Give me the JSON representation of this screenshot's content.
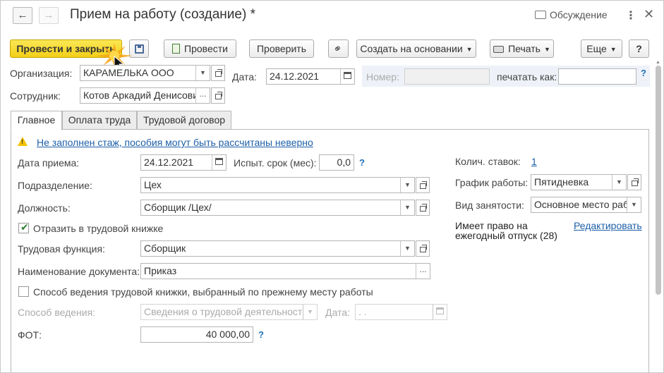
{
  "window": {
    "title": "Прием на работу (создание) *",
    "discussion_label": "Обсуждение"
  },
  "toolbar": {
    "post_close": "Провести и закрыть",
    "post": "Провести",
    "check": "Проверить",
    "create_based": "Создать на основании",
    "print": "Печать",
    "more": "Еще",
    "help": "?"
  },
  "header": {
    "org_label": "Организация:",
    "org_value": "КАРАМЕЛЬКА ООО",
    "date_label": "Дата:",
    "date_value": "24.12.2021",
    "number_label": "Номер:",
    "number_value": "",
    "print_as_label": "печатать как:",
    "print_as_value": "",
    "employee_label": "Сотрудник:",
    "employee_value": "Котов Аркадий Денисови"
  },
  "tabs": [
    "Главное",
    "Оплата труда",
    "Трудовой договор"
  ],
  "main": {
    "warning": "Не заполнен стаж, пособия могут быть рассчитаны неверно",
    "hire_date_label": "Дата приема:",
    "hire_date_value": "24.12.2021",
    "probation_label": "Испыт. срок (мес):",
    "probation_value": "0,0",
    "dept_label": "Подразделение:",
    "dept_value": "Цех",
    "position_label": "Должность:",
    "position_value": "Сборщик /Цех/",
    "workbook_checkbox": "Отразить в трудовой книжке",
    "workbook_checked": true,
    "labor_function_label": "Трудовая функция:",
    "labor_function_value": "Сборщик",
    "doc_name_label": "Наименование документа:",
    "doc_name_value": "Приказ",
    "prev_method_checkbox": "Способ ведения трудовой книжки, выбранный по прежнему месту работы",
    "prev_method_checked": false,
    "method_label": "Способ ведения:",
    "method_value": "Сведения о трудовой деятельности",
    "method_date_label": "Дата:",
    "method_date_value": " .  .",
    "fot_label": "ФОТ:",
    "fot_value": "40 000,00",
    "rates_label": "Колич. ставок:",
    "rates_value": "1",
    "schedule_label": "График работы:",
    "schedule_value": "Пятидневка",
    "employment_label": "Вид занятости:",
    "employment_value": "Основное место раб",
    "vacation_line1": "Имеет право на",
    "vacation_line2": "ежегодный отпуск (28)",
    "edit_link": "Редактировать"
  },
  "colors": {
    "primary_button": "#f2cf17",
    "link": "#1d5fa8",
    "warning": "#f2c200"
  }
}
